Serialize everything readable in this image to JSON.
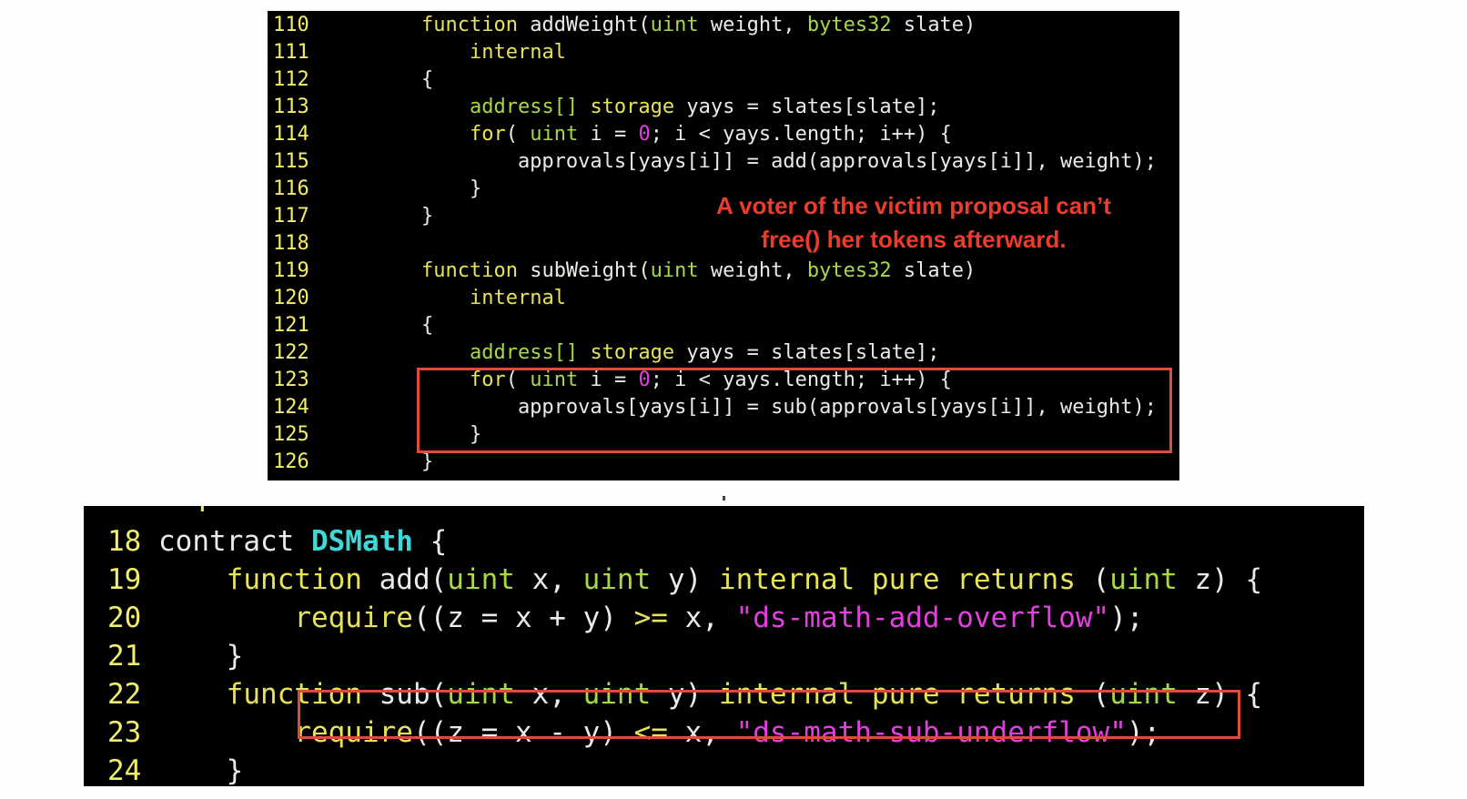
{
  "top_panel": {
    "lines": [
      {
        "num": "110",
        "tokens": [
          [
            "    ",
            ""
          ],
          [
            "function",
            "kw"
          ],
          [
            " addWeight(",
            ""
          ],
          [
            "uint",
            "ty"
          ],
          [
            " weight, ",
            ""
          ],
          [
            "bytes32",
            "ty"
          ],
          [
            " slate)",
            ""
          ]
        ]
      },
      {
        "num": "111",
        "tokens": [
          [
            "        ",
            ""
          ],
          [
            "internal",
            "kw"
          ]
        ]
      },
      {
        "num": "112",
        "tokens": [
          [
            "    {",
            ""
          ]
        ]
      },
      {
        "num": "113",
        "tokens": [
          [
            "        ",
            ""
          ],
          [
            "address[]",
            "ty"
          ],
          [
            " ",
            ""
          ],
          [
            "storage",
            "kw"
          ],
          [
            " yays = slates[slate];",
            ""
          ]
        ]
      },
      {
        "num": "114",
        "tokens": [
          [
            "        ",
            ""
          ],
          [
            "for",
            "kw"
          ],
          [
            "( ",
            ""
          ],
          [
            "uint",
            "ty"
          ],
          [
            " i = ",
            ""
          ],
          [
            "0",
            "num"
          ],
          [
            "; i < yays.length; i++) {",
            ""
          ]
        ]
      },
      {
        "num": "115",
        "tokens": [
          [
            "            approvals[yays[i]] = add(approvals[yays[i]], weight);",
            ""
          ]
        ]
      },
      {
        "num": "116",
        "tokens": [
          [
            "        }",
            ""
          ]
        ]
      },
      {
        "num": "117",
        "tokens": [
          [
            "    }",
            ""
          ]
        ]
      },
      {
        "num": "118",
        "tokens": [
          [
            "",
            ""
          ]
        ]
      },
      {
        "num": "119",
        "tokens": [
          [
            "    ",
            ""
          ],
          [
            "function",
            "kw"
          ],
          [
            " subWeight(",
            ""
          ],
          [
            "uint",
            "ty"
          ],
          [
            " weight, ",
            ""
          ],
          [
            "bytes32",
            "ty"
          ],
          [
            " slate)",
            ""
          ]
        ]
      },
      {
        "num": "120",
        "tokens": [
          [
            "        ",
            ""
          ],
          [
            "internal",
            "kw"
          ]
        ]
      },
      {
        "num": "121",
        "tokens": [
          [
            "    {",
            ""
          ]
        ]
      },
      {
        "num": "122",
        "tokens": [
          [
            "        ",
            ""
          ],
          [
            "address[]",
            "ty"
          ],
          [
            " ",
            ""
          ],
          [
            "storage",
            "kw"
          ],
          [
            " yays = slates[slate];",
            ""
          ]
        ]
      },
      {
        "num": "123",
        "tokens": [
          [
            "        ",
            ""
          ],
          [
            "for",
            "kw"
          ],
          [
            "( ",
            ""
          ],
          [
            "uint",
            "ty"
          ],
          [
            " i = ",
            ""
          ],
          [
            "0",
            "num"
          ],
          [
            "; i < yays.length; i++) {",
            ""
          ]
        ]
      },
      {
        "num": "124",
        "tokens": [
          [
            "            approvals[yays[i]] = sub(approvals[yays[i]], weight);",
            ""
          ]
        ]
      },
      {
        "num": "125",
        "tokens": [
          [
            "        }",
            ""
          ]
        ]
      },
      {
        "num": "126",
        "tokens": [
          [
            "    }",
            ""
          ]
        ]
      }
    ],
    "annotation": [
      "A voter of the victim proposal can’t",
      "free() her tokens afterward."
    ]
  },
  "bottom_panel": {
    "lines": [
      {
        "num": "18",
        "tokens": [
          [
            "contract ",
            ""
          ],
          [
            "DSMath",
            "cls"
          ],
          [
            " {",
            ""
          ]
        ]
      },
      {
        "num": "19",
        "tokens": [
          [
            "    ",
            ""
          ],
          [
            "function",
            "kw"
          ],
          [
            " add(",
            ""
          ],
          [
            "uint",
            "ty"
          ],
          [
            " x, ",
            ""
          ],
          [
            "uint",
            "ty"
          ],
          [
            " y) ",
            ""
          ],
          [
            "internal",
            "kw"
          ],
          [
            " ",
            ""
          ],
          [
            "pure",
            "kw"
          ],
          [
            " ",
            ""
          ],
          [
            "returns",
            "kw"
          ],
          [
            " (",
            ""
          ],
          [
            "uint",
            "ty"
          ],
          [
            " z) {",
            ""
          ]
        ]
      },
      {
        "num": "20",
        "tokens": [
          [
            "        ",
            ""
          ],
          [
            "require",
            "kw"
          ],
          [
            "((z = x + y) ",
            ""
          ],
          [
            ">=",
            "kw"
          ],
          [
            " x, ",
            ""
          ],
          [
            "\"ds-math-add-overflow\"",
            "str"
          ],
          [
            ");",
            ""
          ]
        ]
      },
      {
        "num": "21",
        "tokens": [
          [
            "    }",
            ""
          ]
        ]
      },
      {
        "num": "22",
        "tokens": [
          [
            "    ",
            ""
          ],
          [
            "function",
            "kw"
          ],
          [
            " sub(",
            ""
          ],
          [
            "uint",
            "ty"
          ],
          [
            " x, ",
            ""
          ],
          [
            "uint",
            "ty"
          ],
          [
            " y) ",
            ""
          ],
          [
            "internal",
            "kw"
          ],
          [
            " ",
            ""
          ],
          [
            "pure",
            "kw"
          ],
          [
            " ",
            ""
          ],
          [
            "returns",
            "kw"
          ],
          [
            " (",
            ""
          ],
          [
            "uint",
            "ty"
          ],
          [
            " z) {",
            ""
          ]
        ]
      },
      {
        "num": "23",
        "tokens": [
          [
            "        ",
            ""
          ],
          [
            "require",
            "kw"
          ],
          [
            "((z = x - y) ",
            ""
          ],
          [
            "<=",
            "kw"
          ],
          [
            " x, ",
            ""
          ],
          [
            "\"ds-math-sub-underflow\"",
            "str"
          ],
          [
            ");",
            ""
          ]
        ]
      },
      {
        "num": "24",
        "tokens": [
          [
            "    }",
            ""
          ]
        ]
      }
    ]
  }
}
